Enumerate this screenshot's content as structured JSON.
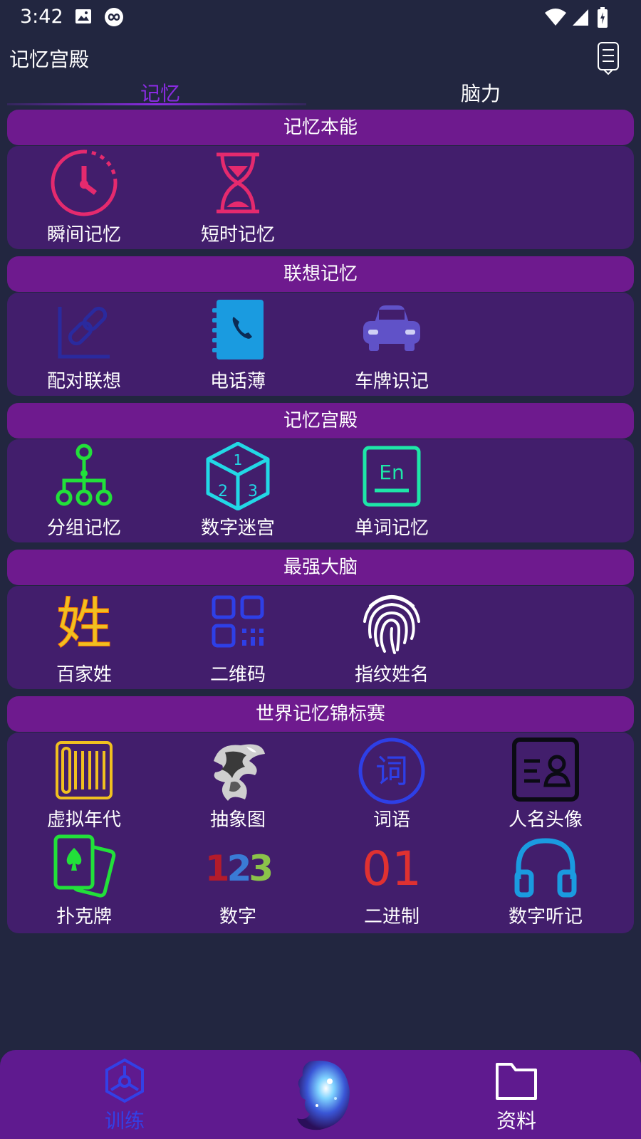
{
  "status_bar": {
    "time": "3:42"
  },
  "app_bar": {
    "title": "记忆宫殿"
  },
  "tabs": [
    {
      "label": "记忆",
      "active": true
    },
    {
      "label": "脑力",
      "active": false
    }
  ],
  "sections": [
    {
      "title": "记忆本能",
      "items": [
        {
          "label": "瞬间记忆",
          "icon": "clock-icon"
        },
        {
          "label": "短时记忆",
          "icon": "hourglass-icon"
        }
      ]
    },
    {
      "title": "联想记忆",
      "items": [
        {
          "label": "配对联想",
          "icon": "link-icon"
        },
        {
          "label": "电话薄",
          "icon": "phonebook-icon"
        },
        {
          "label": "车牌识记",
          "icon": "car-icon"
        }
      ]
    },
    {
      "title": "记忆宫殿",
      "items": [
        {
          "label": "分组记忆",
          "icon": "hierarchy-icon"
        },
        {
          "label": "数字迷宫",
          "icon": "number-cube-icon"
        },
        {
          "label": "单词记忆",
          "icon": "english-word-icon"
        }
      ]
    },
    {
      "title": "最强大脑",
      "items": [
        {
          "label": "百家姓",
          "icon": "surname-icon",
          "icon_text": "姓"
        },
        {
          "label": "二维码",
          "icon": "qr-code-icon"
        },
        {
          "label": "指纹姓名",
          "icon": "fingerprint-icon"
        }
      ]
    },
    {
      "title": "世界记忆锦标赛",
      "items": [
        {
          "label": "虚拟年代",
          "icon": "historic-dates-icon"
        },
        {
          "label": "抽象图",
          "icon": "abstract-image-icon"
        },
        {
          "label": "词语",
          "icon": "words-icon",
          "icon_text": "词"
        },
        {
          "label": "人名头像",
          "icon": "names-faces-icon"
        },
        {
          "label": "扑克牌",
          "icon": "playing-cards-icon"
        },
        {
          "label": "数字",
          "icon": "numbers-icon",
          "icon_text": "123"
        },
        {
          "label": "二进制",
          "icon": "binary-icon",
          "icon_text": "01"
        },
        {
          "label": "数字听记",
          "icon": "headphones-icon"
        }
      ]
    }
  ],
  "bottom_nav": [
    {
      "label": "训练",
      "icon": "training-network-icon",
      "active": true
    },
    {
      "label": "",
      "icon": "brain-orb-icon"
    },
    {
      "label": "资料",
      "icon": "folder-icon",
      "active": false
    }
  ],
  "colors": {
    "background": "#222640",
    "section_header": "#6e1a8e",
    "section_body": "#421e6c",
    "accent": "#8a2be2",
    "bottom_nav": "#5f1a8f"
  }
}
